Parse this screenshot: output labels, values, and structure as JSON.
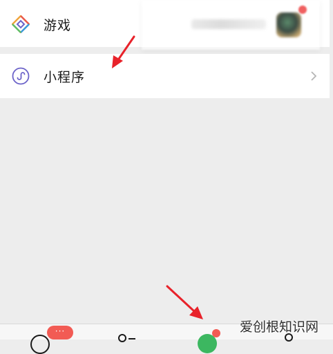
{
  "list": {
    "games_label": "游戏",
    "mini_programs_label": "小程序"
  },
  "tabbar": {
    "chats_badge": "···"
  },
  "watermark": {
    "text": "爱创根知识网"
  },
  "colors": {
    "background": "#ededed",
    "row_background": "#ffffff",
    "badge_red": "#f25b54",
    "discover_green": "#3cb760",
    "arrow_red": "#e8222a",
    "mini_program_icon": "#6c63c9"
  },
  "icons": {
    "games": "games-diamond-icon",
    "mini_programs": "mini-program-icon",
    "chevron": "chevron-right-icon",
    "annotation_arrow": "red-arrow-icon"
  }
}
